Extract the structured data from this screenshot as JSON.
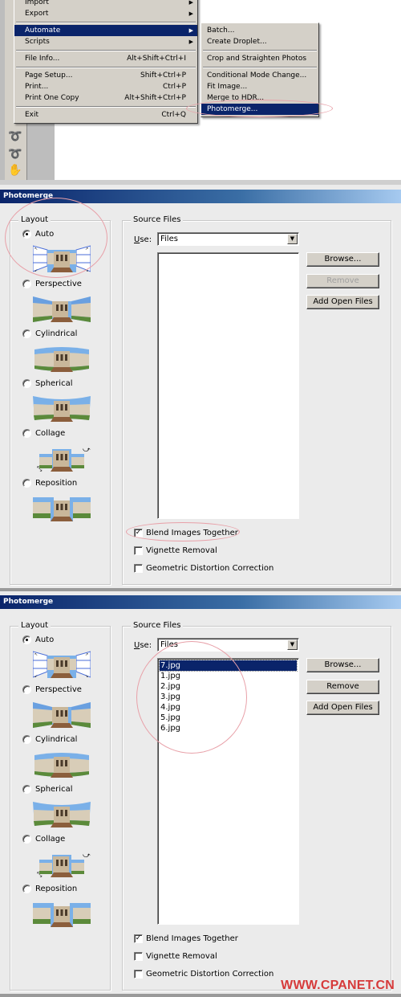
{
  "file_menu": {
    "items": [
      {
        "label": "Import",
        "shortcut": "",
        "submenu": true
      },
      {
        "label": "Export",
        "shortcut": "",
        "submenu": true
      },
      {
        "label": "Automate",
        "shortcut": "",
        "submenu": true,
        "highlighted": true
      },
      {
        "label": "Scripts",
        "shortcut": "",
        "submenu": true
      },
      {
        "label": "File Info...",
        "shortcut": "Alt+Shift+Ctrl+I"
      },
      {
        "label": "Page Setup...",
        "shortcut": "Shift+Ctrl+P"
      },
      {
        "label": "Print...",
        "shortcut": "Ctrl+P"
      },
      {
        "label": "Print One Copy",
        "shortcut": "Alt+Shift+Ctrl+P"
      },
      {
        "label": "Exit",
        "shortcut": "Ctrl+Q"
      }
    ]
  },
  "automate_menu": {
    "items": [
      {
        "label": "Batch..."
      },
      {
        "label": "Create Droplet..."
      },
      {
        "label": "Crop and Straighten Photos"
      },
      {
        "label": "Conditional Mode Change..."
      },
      {
        "label": "Fit Image..."
      },
      {
        "label": "Merge to HDR..."
      },
      {
        "label": "Photomerge...",
        "highlighted": true
      }
    ]
  },
  "dialogs": [
    {
      "title": "Photomerge",
      "layout_legend": "Layout",
      "layout_options": [
        {
          "label": "Auto",
          "selected": true,
          "icon": "auto-layout-preview"
        },
        {
          "label": "Perspective",
          "selected": false,
          "icon": "perspective-layout-preview"
        },
        {
          "label": "Cylindrical",
          "selected": false,
          "icon": "cylindrical-layout-preview"
        },
        {
          "label": "Spherical",
          "selected": false,
          "icon": "spherical-layout-preview"
        },
        {
          "label": "Collage",
          "selected": false,
          "icon": "collage-layout-preview"
        },
        {
          "label": "Reposition",
          "selected": false,
          "icon": "reposition-layout-preview"
        }
      ],
      "source_legend": "Source Files",
      "use_label": "Use:",
      "use_value": "Files",
      "files": [],
      "buttons": [
        {
          "label": "Browse...",
          "enabled": true
        },
        {
          "label": "Remove",
          "enabled": false
        },
        {
          "label": "Add Open Files",
          "enabled": true
        }
      ],
      "options": [
        {
          "label": "Blend Images Together",
          "checked": true
        },
        {
          "label": "Vignette Removal",
          "checked": false
        },
        {
          "label": "Geometric Distortion Correction",
          "checked": false
        }
      ]
    },
    {
      "title": "Photomerge",
      "layout_legend": "Layout",
      "layout_options": [
        {
          "label": "Auto",
          "selected": true,
          "icon": "auto-layout-preview"
        },
        {
          "label": "Perspective",
          "selected": false,
          "icon": "perspective-layout-preview"
        },
        {
          "label": "Cylindrical",
          "selected": false,
          "icon": "cylindrical-layout-preview"
        },
        {
          "label": "Spherical",
          "selected": false,
          "icon": "spherical-layout-preview"
        },
        {
          "label": "Collage",
          "selected": false,
          "icon": "collage-layout-preview"
        },
        {
          "label": "Reposition",
          "selected": false,
          "icon": "reposition-layout-preview"
        }
      ],
      "source_legend": "Source Files",
      "use_label": "Use:",
      "use_value": "Files",
      "files": [
        "7.jpg",
        "1.jpg",
        "2.jpg",
        "3.jpg",
        "4.jpg",
        "5.jpg",
        "6.jpg"
      ],
      "selected_file": "7.jpg",
      "buttons": [
        {
          "label": "Browse...",
          "enabled": true
        },
        {
          "label": "Remove",
          "enabled": true
        },
        {
          "label": "Add Open Files",
          "enabled": true
        }
      ],
      "options": [
        {
          "label": "Blend Images Together",
          "checked": true
        },
        {
          "label": "Vignette Removal",
          "checked": false
        },
        {
          "label": "Geometric Distortion Correction",
          "checked": false
        }
      ]
    }
  ],
  "colors": {
    "highlight": "#0a246a",
    "annotation": "#e8a0a8",
    "watermark": "#d63a3a"
  },
  "watermark": "WWW.CPANET.CN"
}
